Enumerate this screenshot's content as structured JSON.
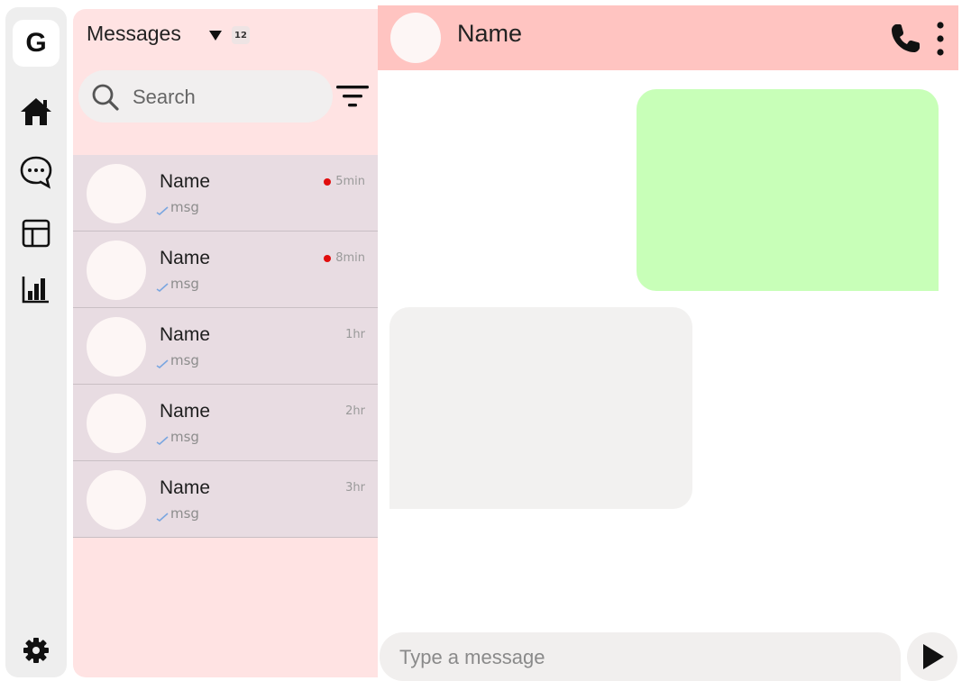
{
  "rail": {
    "logo": "G",
    "items": [
      {
        "icon": "home-icon"
      },
      {
        "icon": "chat-bubble-icon"
      },
      {
        "icon": "layout-icon"
      },
      {
        "icon": "bar-chart-icon"
      }
    ],
    "settings_icon": "gear-icon"
  },
  "messages": {
    "title": "Messages",
    "count": "12",
    "search_placeholder": "Search",
    "filter_icon": "filter-icon"
  },
  "conversations": [
    {
      "name": "Name",
      "preview": "msg",
      "time": "5min",
      "unread": true
    },
    {
      "name": "Name",
      "preview": "msg",
      "time": "8min",
      "unread": true
    },
    {
      "name": "Name",
      "preview": "msg",
      "time": "1hr",
      "unread": false
    },
    {
      "name": "Name",
      "preview": "msg",
      "time": "2hr",
      "unread": false
    },
    {
      "name": "Name",
      "preview": "msg",
      "time": "3hr",
      "unread": false
    }
  ],
  "chat": {
    "contact_name": "Name",
    "composer_placeholder": "Type a message"
  },
  "colors": {
    "header": "#ffc4c1",
    "panel": "#ffe3e3",
    "conversation_row": "#e8dce2",
    "outgoing_bubble": "#c8ffb8",
    "incoming_bubble": "#f2f1f0",
    "unread_dot": "#e10d0d"
  }
}
